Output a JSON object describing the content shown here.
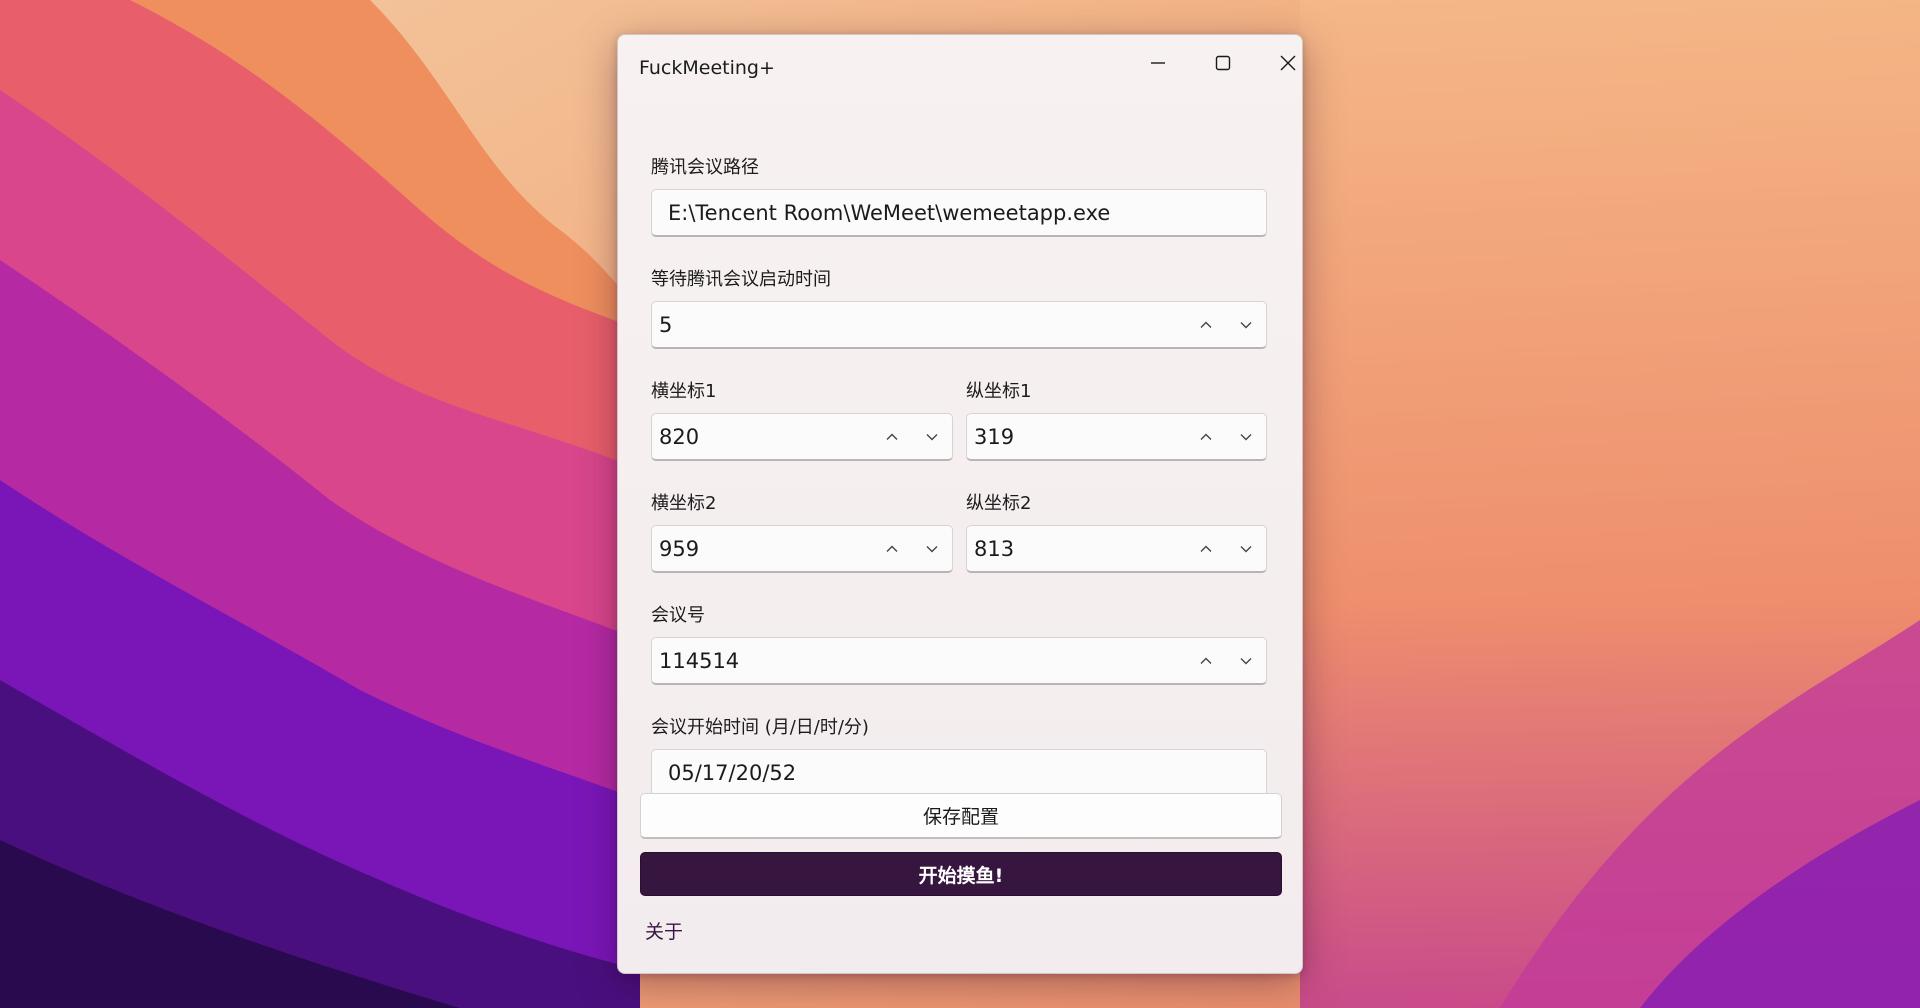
{
  "window": {
    "title": "FuckMeeting+"
  },
  "form": {
    "path_label": "腾讯会议路径",
    "path_value": "E:\\Tencent Room\\WeMeet\\wemeetapp.exe",
    "wait_label": "等待腾讯会议启动时间",
    "wait_value": "5",
    "x1_label": "横坐标1",
    "x1_value": "820",
    "y1_label": "纵坐标1",
    "y1_value": "319",
    "x2_label": "横坐标2",
    "x2_value": "959",
    "y2_label": "纵坐标2",
    "y2_value": "813",
    "meeting_id_label": "会议号",
    "meeting_id_value": "114514",
    "start_time_label": "会议开始时间 (月/日/时/分)",
    "start_time_value": "05/17/20/52"
  },
  "buttons": {
    "save_label": "保存配置",
    "start_label": "开始摸鱼!",
    "about_label": "关于"
  },
  "icons": {
    "minimize": "minimize-icon",
    "maximize": "maximize-icon",
    "close": "close-icon",
    "increment": "chevron-up-icon",
    "decrement": "chevron-down-icon"
  },
  "colors": {
    "accent": "#36163f",
    "window_bg": "#f6f0f0"
  }
}
